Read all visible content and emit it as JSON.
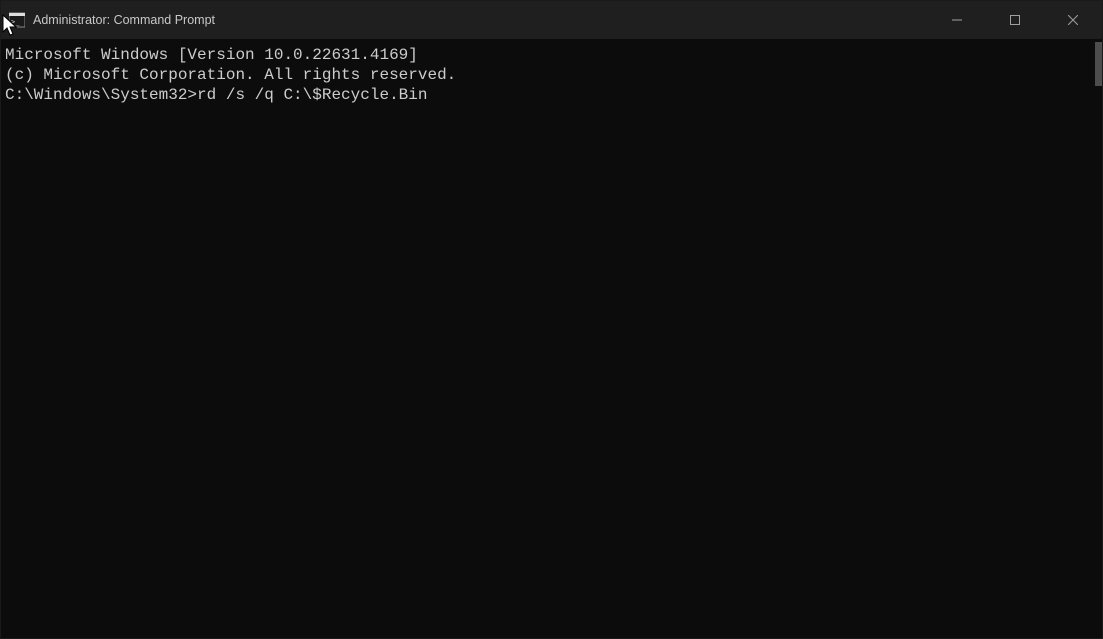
{
  "window": {
    "title": "Administrator: Command Prompt"
  },
  "terminal": {
    "lines": [
      "Microsoft Windows [Version 10.0.22631.4169]",
      "(c) Microsoft Corporation. All rights reserved.",
      "",
      "C:\\Windows\\System32>rd /s /q C:\\$Recycle.Bin"
    ]
  }
}
